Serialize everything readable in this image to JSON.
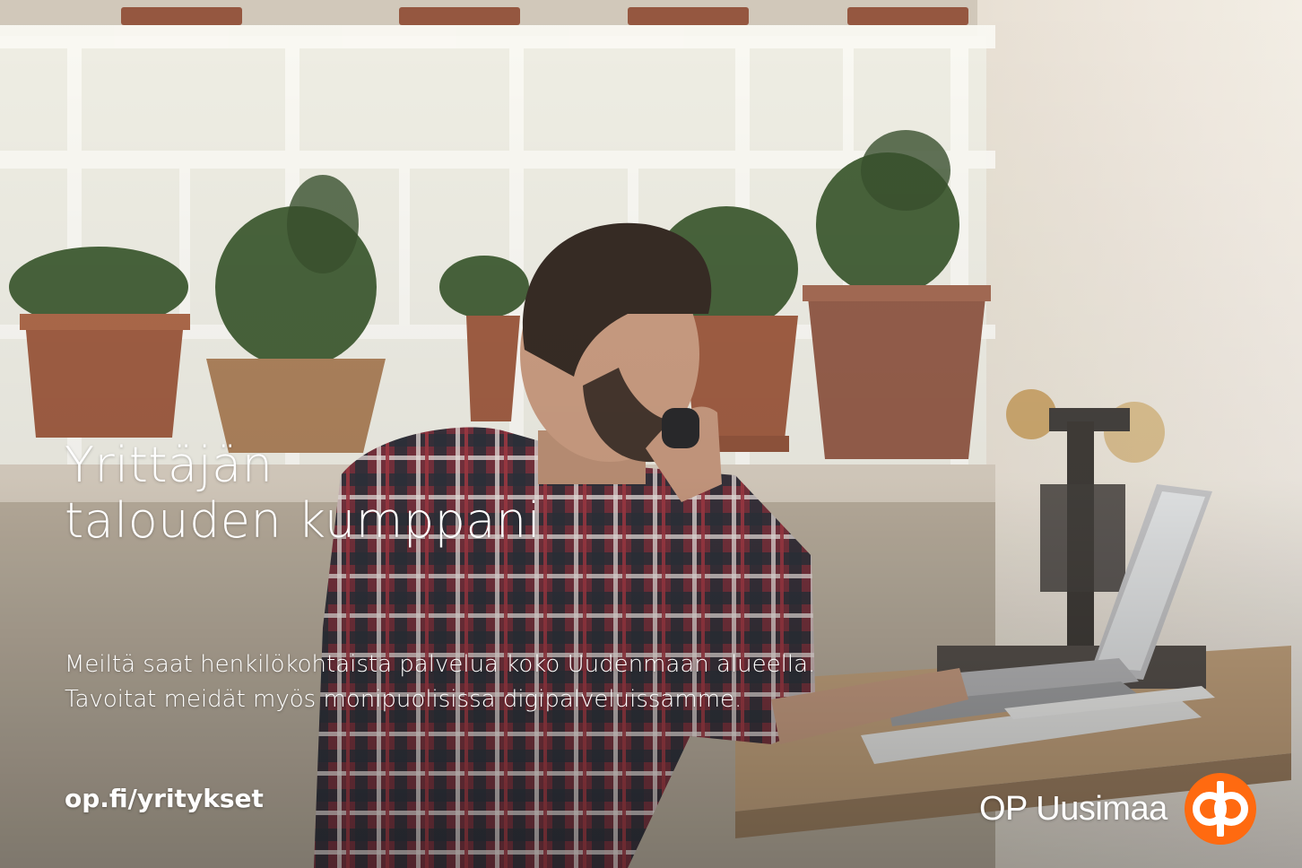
{
  "headline": {
    "line1": "Yrittäjän",
    "line2": "talouden kumppani"
  },
  "body": {
    "line1": "Meiltä saat henkilökohtaista palvelua koko Uudenmaan alueella.",
    "line2": "Tavoitat meidät myös monipuolisissa digipalveluissamme."
  },
  "link": {
    "text": "op.fi/yritykset"
  },
  "brand": {
    "name": "OP Uusimaa",
    "logo": "op-logo-icon",
    "color": "#ff6a10"
  },
  "photo": {
    "subject": "man-on-phone-with-laptop-icon"
  }
}
